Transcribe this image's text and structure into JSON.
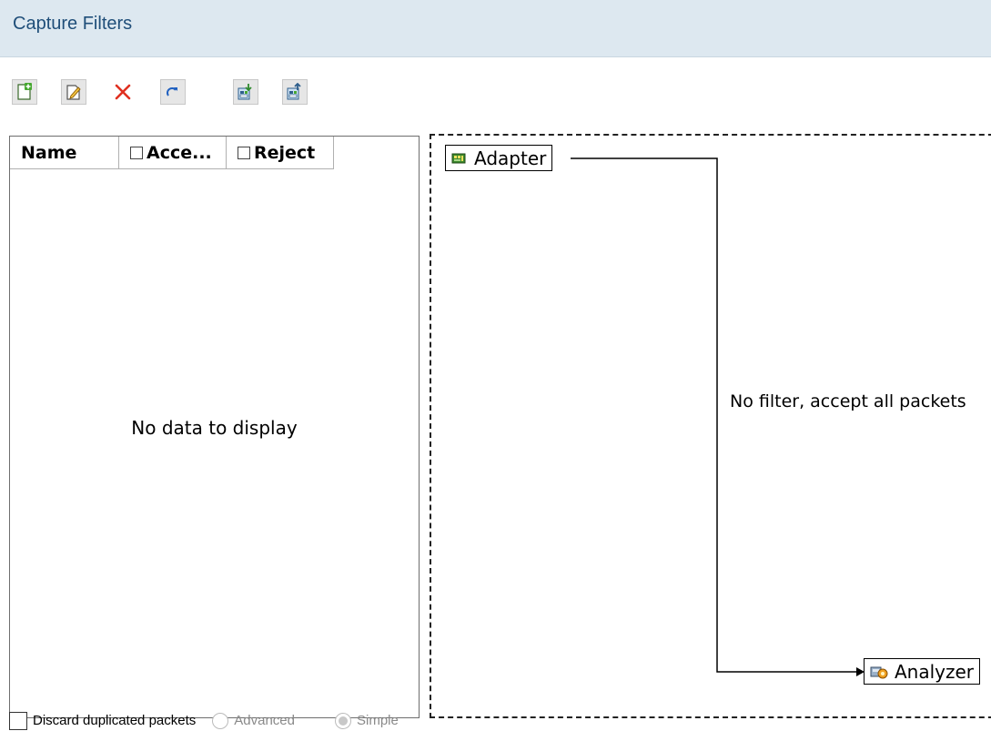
{
  "header": {
    "title": "Capture Filters"
  },
  "toolbar": {
    "buttons": [
      {
        "name": "add-filter-button",
        "icon": "new-document-icon"
      },
      {
        "name": "edit-filter-button",
        "icon": "edit-icon"
      },
      {
        "name": "delete-filter-button",
        "icon": "delete-x-icon"
      },
      {
        "name": "refresh-button",
        "icon": "redo-arrow-icon"
      },
      {
        "name": "import-button",
        "icon": "import-icon"
      },
      {
        "name": "export-button",
        "icon": "export-icon"
      }
    ]
  },
  "grid": {
    "columns": [
      {
        "label": "Name",
        "checkbox": false
      },
      {
        "label": "Acce...",
        "checkbox": true
      },
      {
        "label": "Reject",
        "checkbox": true
      }
    ],
    "rows": [],
    "empty_text": "No data to display"
  },
  "flow": {
    "source_node": "Adapter",
    "target_node": "Analyzer",
    "label": "No filter, accept all packets"
  },
  "bottom": {
    "discard_label": "Discard duplicated packets",
    "discard_checked": false,
    "mode_advanced_label": "Advanced",
    "mode_simple_label": "Simple",
    "selected_mode": "Simple"
  },
  "colors": {
    "header_bg": "#dde8f0",
    "header_text": "#1f4e79",
    "delete_red": "#e03020"
  }
}
